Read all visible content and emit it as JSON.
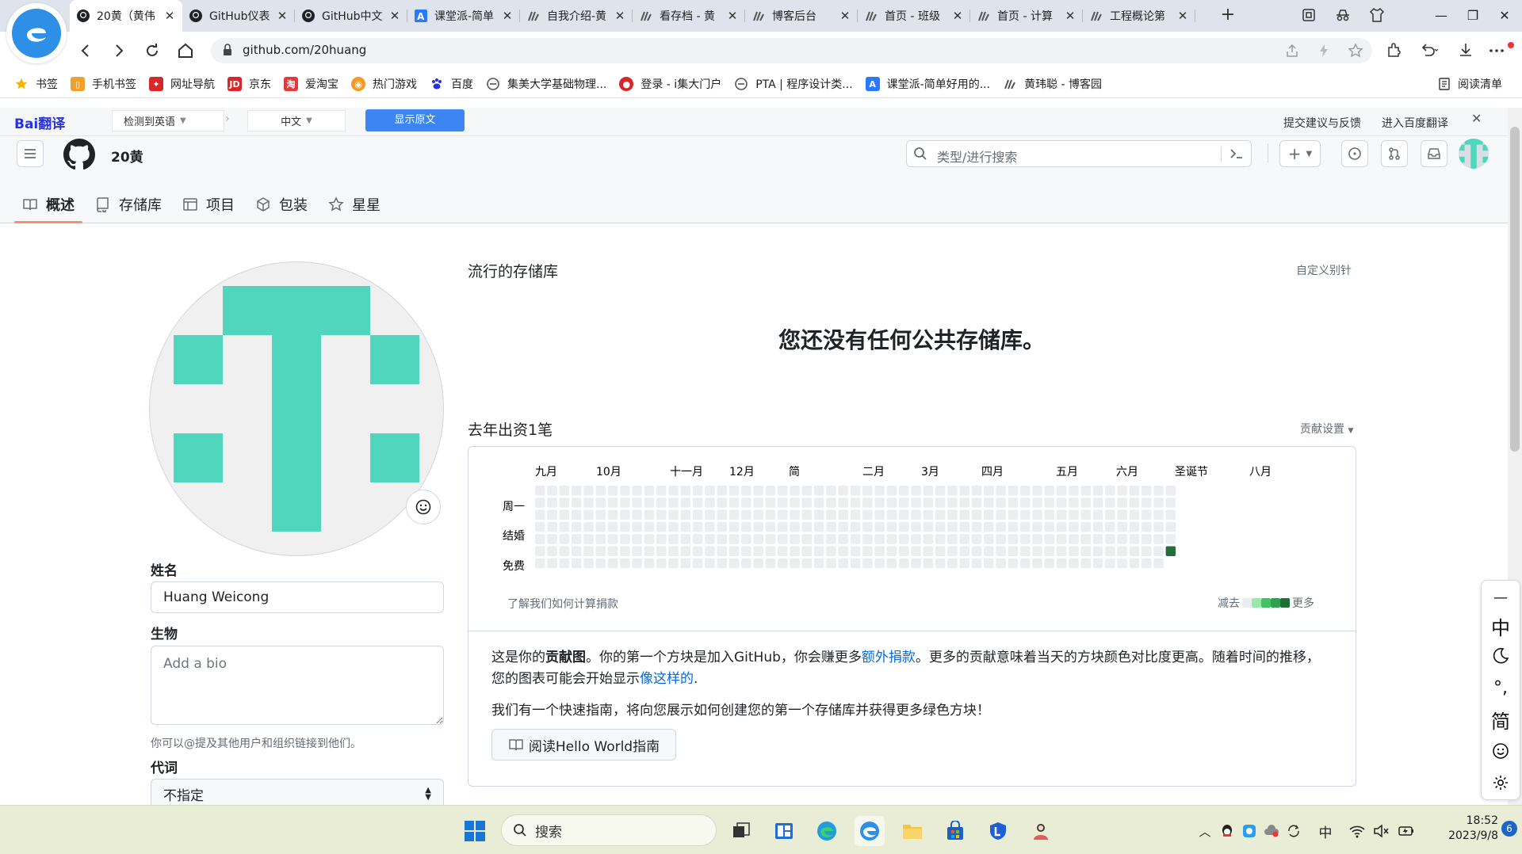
{
  "browser": {
    "tabs": [
      {
        "title": "20黄（黄伟",
        "icon": "github-icon",
        "active": true
      },
      {
        "title": "GitHub仪表",
        "icon": "github-icon"
      },
      {
        "title": "GitHub中文",
        "icon": "github-icon"
      },
      {
        "title": "课堂派-简单",
        "icon": "ketangpai-icon"
      },
      {
        "title": "自我介绍-黄",
        "icon": "cnblogs-icon"
      },
      {
        "title": "看存档 - 黄",
        "icon": "cnblogs-icon"
      },
      {
        "title": "博客后台",
        "icon": "cnblogs-icon"
      },
      {
        "title": "首页 - 班级",
        "icon": "cnblogs-icon"
      },
      {
        "title": "首页 - 计算",
        "icon": "cnblogs-icon"
      },
      {
        "title": "工程概论第",
        "icon": "cnblogs-icon"
      }
    ],
    "url": "github.com/20huang",
    "bookmarks": [
      {
        "label": "书签",
        "icon": "star-icon",
        "color": "#f5b400"
      },
      {
        "label": "手机书签",
        "icon": "phone-bookmark-icon",
        "color": "#f0a030"
      },
      {
        "label": "网址导航",
        "icon": "nav-icon",
        "color": "#d8262b"
      },
      {
        "label": "京东",
        "icon": "jd-icon",
        "color": "#d8262b"
      },
      {
        "label": "爱淘宝",
        "icon": "taobao-icon",
        "color": "#e4393c"
      },
      {
        "label": "热门游戏",
        "icon": "game-icon",
        "color": "#f59a23"
      },
      {
        "label": "百度",
        "icon": "baidu-paw-icon",
        "color": "#2932e1"
      },
      {
        "label": "集美大学基础物理...",
        "icon": "link-icon",
        "color": "#555555"
      },
      {
        "label": "登录 - i集大门户",
        "icon": "portal-icon",
        "color": "#d8262b"
      },
      {
        "label": "PTA | 程序设计类...",
        "icon": "link-icon",
        "color": "#555555"
      },
      {
        "label": "课堂派-简单好用的...",
        "icon": "ketangpai-icon",
        "color": "#2979ff"
      },
      {
        "label": "黄玮聪 - 博客园",
        "icon": "cnblogs-icon",
        "color": "#555555"
      }
    ],
    "reading_list": "阅读清单"
  },
  "translate_bar": {
    "brand": "Bai翻译",
    "source_lang": "检测到英语",
    "target_lang": "中文",
    "show_original": "显示原文",
    "feedback": "提交建议与反馈",
    "enter": "进入百度翻译"
  },
  "github": {
    "profile_name": "20黄",
    "search_placeholder": "类型/进行搜索",
    "tabs": [
      {
        "label": "概述",
        "icon": "book-icon",
        "active": true
      },
      {
        "label": "存储库",
        "icon": "repo-icon"
      },
      {
        "label": "项目",
        "icon": "table-icon"
      },
      {
        "label": "包装",
        "icon": "package-icon"
      },
      {
        "label": "星星",
        "icon": "star-outline-icon"
      }
    ],
    "sidebar": {
      "name_label": "姓名",
      "name_value": "Huang Weicong",
      "bio_label": "生物",
      "bio_placeholder": "Add a bio",
      "bio_hint": "你可以@提及其他用户和组织链接到他们。",
      "pronouns_label": "代词",
      "pronouns_value": "不指定"
    },
    "popular": {
      "title": "流行的存储库",
      "customize": "自定义别针",
      "empty": "您还没有任何公共存储库。"
    },
    "contributions": {
      "title": "去年出资1笔",
      "settings": "贡献设置",
      "months": [
        "九月",
        "10月",
        "十一月",
        "12月",
        "简",
        "二月",
        "3月",
        "四月",
        "五月",
        "六月",
        "圣诞节",
        "八月"
      ],
      "days": [
        "周一",
        "结婚",
        "免费"
      ],
      "learn": "了解我们如何计算捐款",
      "legend_less": "减去",
      "legend_more": "更多",
      "colors": [
        "#ebedf0",
        "#9be9a8",
        "#40c463",
        "#30a14e",
        "#216e39"
      ],
      "intro_1": "这是你的",
      "intro_bold": "贡献图",
      "intro_2": "。你的第一个方块是加入GitHub，你会赚更多",
      "intro_link1": "额外捐款",
      "intro_3": "。更多的贡献意味着当天的方块颜色对比度更高。随着时间的推移，您的图表可能会开始显示",
      "intro_link2": "像这样的",
      "intro_4": ".",
      "guide_text": "我们有一个快速指南，将向您展示如何创建您的第一个存储库并获得更多绿色方块！",
      "guide_button": "阅读Hello World指南"
    }
  },
  "ime": {
    "items": [
      "中",
      "简"
    ]
  },
  "taskbar": {
    "search": "搜索",
    "tray_lang": "中",
    "time": "18:52",
    "date": "2023/9/8",
    "notifications": "6"
  },
  "colors": {
    "avatar_teal": "#4fd6bd",
    "accent_tab": "#fd8c73",
    "link": "#0969da",
    "translate_button": "#3c86f4"
  }
}
